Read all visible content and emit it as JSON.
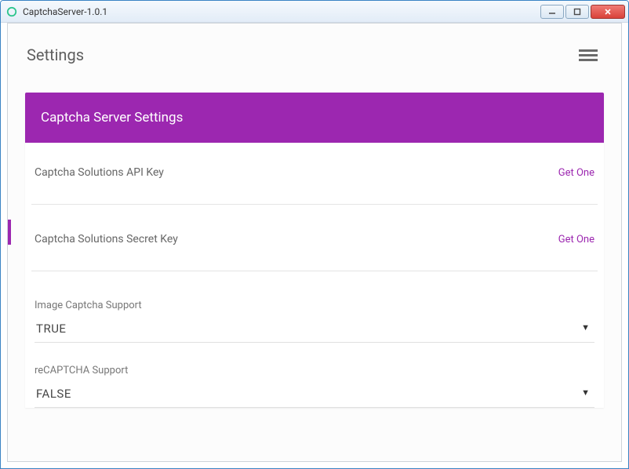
{
  "window": {
    "title": "CaptchaServer-1.0.1"
  },
  "header": {
    "page_title": "Settings"
  },
  "card": {
    "title": "Captcha Server Settings"
  },
  "fields": {
    "api_key": {
      "label": "Captcha Solutions API Key",
      "link": "Get One"
    },
    "secret_key": {
      "label": "Captcha Solutions Secret Key",
      "link": "Get One"
    }
  },
  "selects": {
    "image_captcha": {
      "label": "Image Captcha Support",
      "value": "TRUE"
    },
    "recaptcha": {
      "label": "reCAPTCHA Support",
      "value": "FALSE"
    }
  },
  "colors": {
    "accent": "#9c27b0"
  }
}
